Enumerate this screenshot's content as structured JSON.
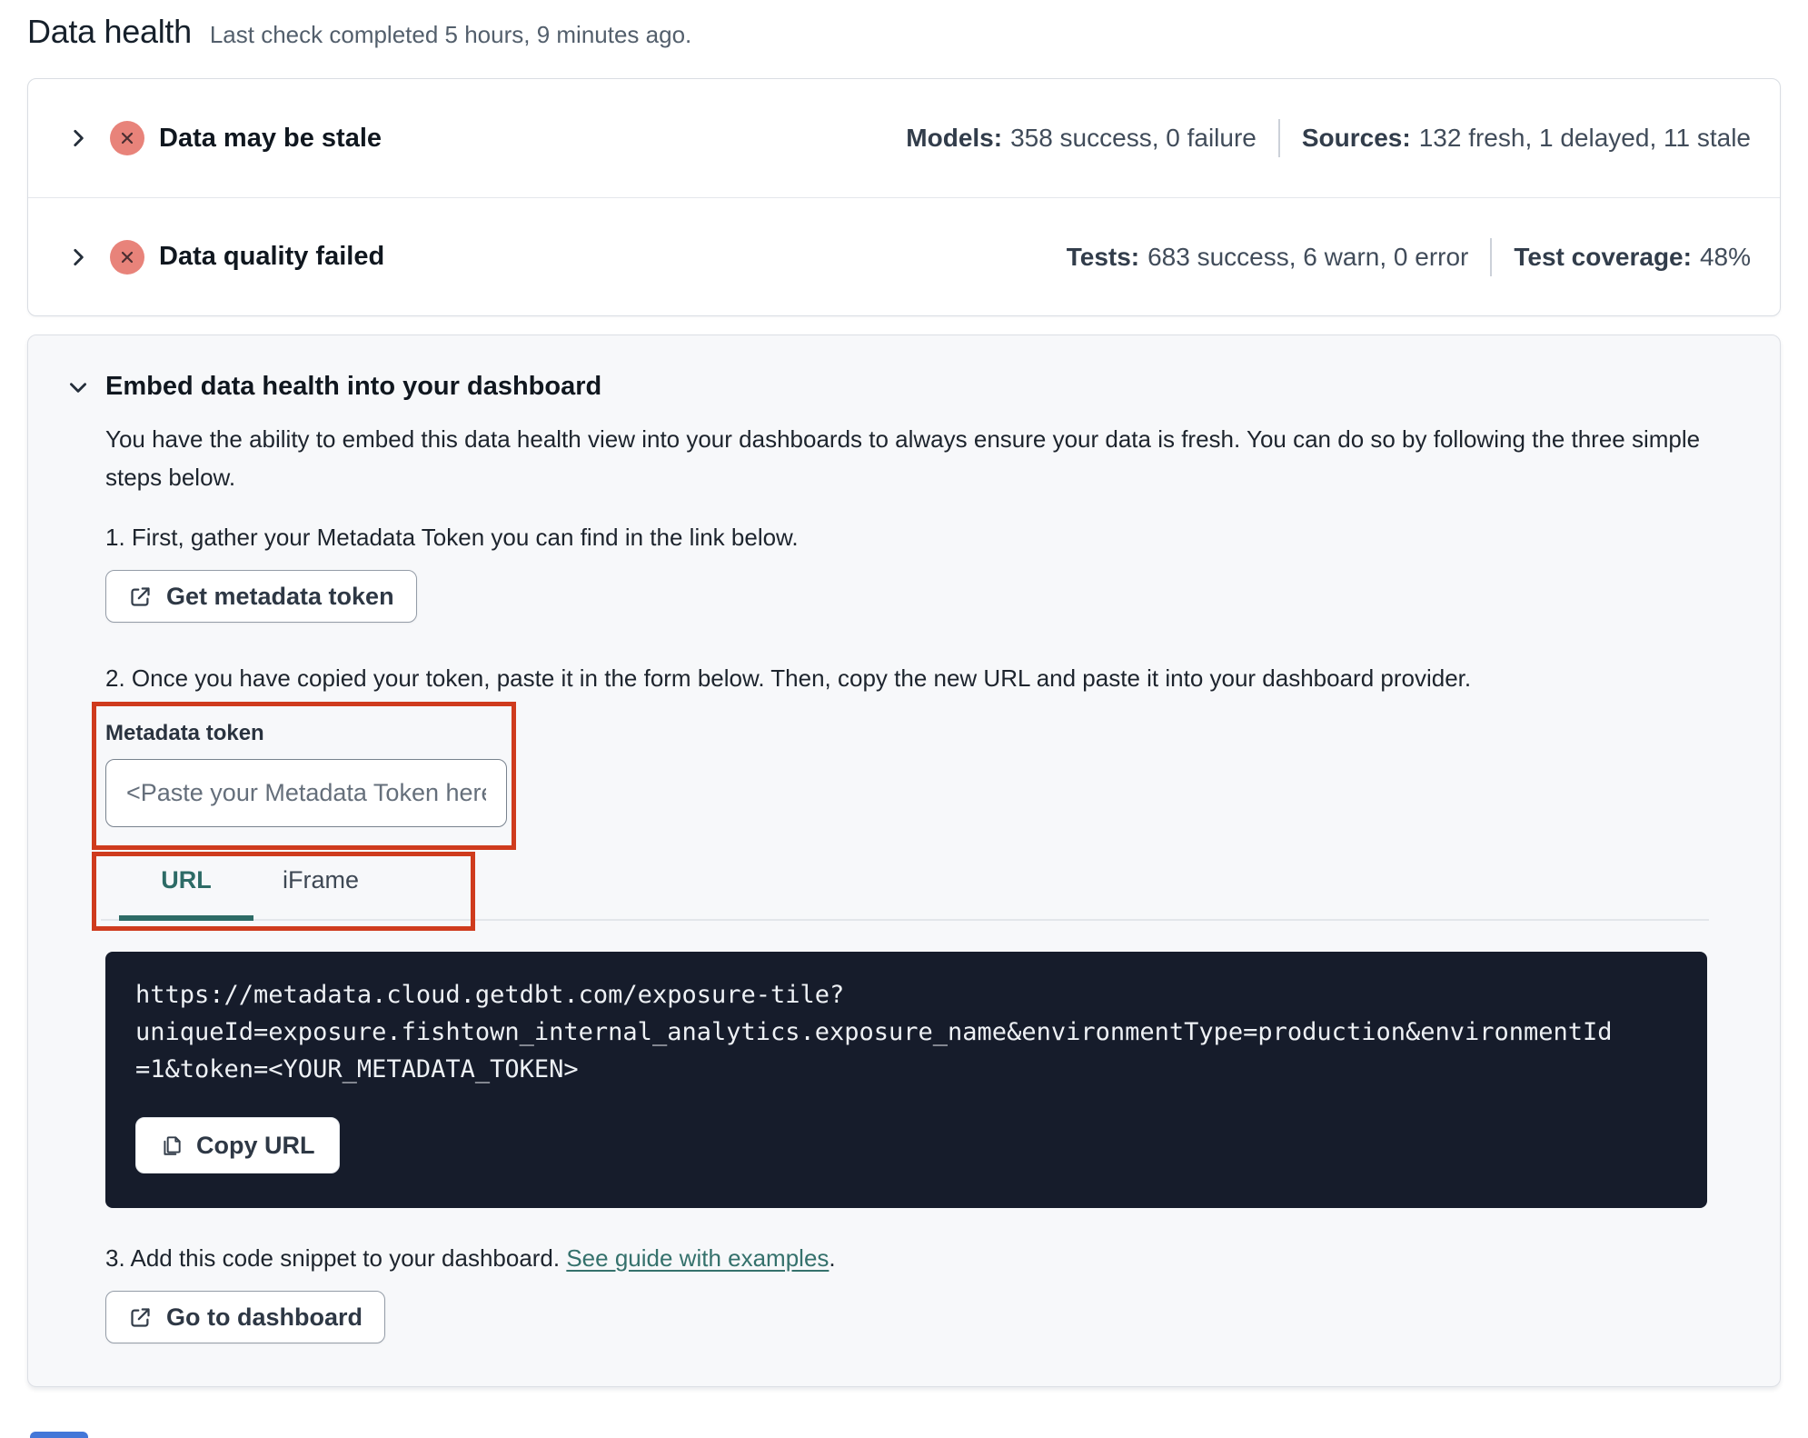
{
  "page": {
    "title": "Data health",
    "subtitle": "Last check completed 5 hours, 9 minutes ago."
  },
  "status_card": {
    "rows": [
      {
        "label": "Data may be stale",
        "status": "error",
        "stats": [
          {
            "name": "Models:",
            "value": "358 success, 0 failure"
          },
          {
            "name": "Sources:",
            "value": "132 fresh, 1 delayed, 11 stale"
          }
        ]
      },
      {
        "label": "Data quality failed",
        "status": "error",
        "stats": [
          {
            "name": "Tests:",
            "value": "683 success, 6 warn, 0 error"
          },
          {
            "name": "Test coverage:",
            "value": "48%"
          }
        ]
      }
    ]
  },
  "embed": {
    "title": "Embed data health into your dashboard",
    "description": "You have the ability to embed this data health view into your dashboards to always ensure your data is fresh. You can do so by following the three simple steps below.",
    "step1_text": "1. First, gather your Metadata Token you can find in the link below.",
    "get_token_button": "Get metadata token",
    "step2_text": "2. Once you have copied your token, paste it in the form below. Then, copy the new URL and paste it into your dashboard provider.",
    "token_label": "Metadata token",
    "token_placeholder": "<Paste your Metadata Token here>",
    "tabs": [
      {
        "label": "URL",
        "active": true
      },
      {
        "label": "iFrame",
        "active": false
      }
    ],
    "code_lines": [
      "https://metadata.cloud.getdbt.com/exposure-tile?",
      "uniqueId=exposure.fishtown_internal_analytics.exposure_name&environmentType=production&environmentId",
      "=1&token=<YOUR_METADATA_TOKEN>"
    ],
    "copy_button": "Copy URL",
    "step3_text": "3. Add this code snippet to your dashboard. ",
    "step3_link": "See guide with examples",
    "step3_suffix": ".",
    "dashboard_button": "Go to dashboard"
  },
  "colors": {
    "accent_teal": "#2d6b66",
    "error_badge": "#e8837a",
    "annotation_red": "#cf3b1d",
    "code_background": "#161c2b"
  }
}
